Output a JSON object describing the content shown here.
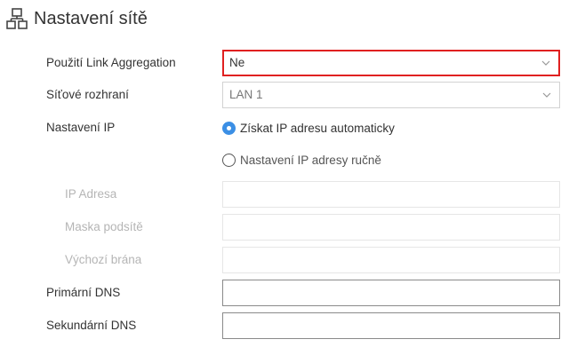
{
  "header": {
    "icon": "network-icon",
    "title": "Nastavení sítě"
  },
  "fields": {
    "link_aggregation": {
      "label": "Použití Link Aggregation",
      "value": "Ne",
      "highlight_color": "#e02020"
    },
    "interface": {
      "label": "Síťové rozhraní",
      "value": "LAN 1"
    },
    "ip_settings": {
      "label": "Nastavení IP",
      "options": [
        {
          "label": "Získat IP adresu automaticky",
          "selected": true
        },
        {
          "label": "Nastavení IP adresy ručně",
          "selected": false
        }
      ],
      "accent": "#3b8fe5"
    },
    "ip_address": {
      "label": "IP Adresa",
      "value": ""
    },
    "subnet_mask": {
      "label": "Maska podsítě",
      "value": ""
    },
    "gateway": {
      "label": "Výchozí brána",
      "value": ""
    },
    "primary_dns": {
      "label": "Primární DNS",
      "value": ""
    },
    "secondary_dns": {
      "label": "Sekundární DNS",
      "value": ""
    }
  }
}
